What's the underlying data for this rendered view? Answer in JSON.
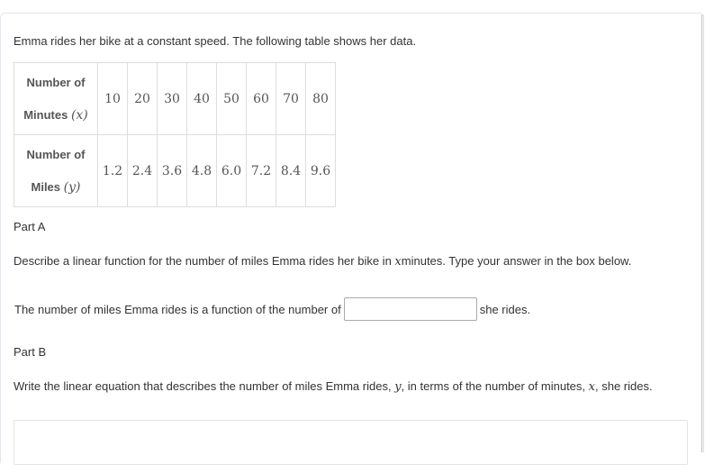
{
  "intro": "Emma rides her bike at a constant speed.  The following table shows her data.",
  "table": {
    "rows": [
      {
        "label_line1": "Number of",
        "label_line2": "Minutes",
        "label_var": "(x)",
        "values": [
          "10",
          "20",
          "30",
          "40",
          "50",
          "60",
          "70",
          "80"
        ]
      },
      {
        "label_line1": "Number of",
        "label_line2": "Miles",
        "label_var": "(y)",
        "values": [
          "1.2",
          "2.4",
          "3.6",
          "4.8",
          "6.0",
          "7.2",
          "8.4",
          "9.6"
        ]
      }
    ]
  },
  "partA": {
    "title": "Part A",
    "prompt_before": "Describe a linear function for the number of miles Emma rides her bike in ",
    "prompt_var": "x",
    "prompt_after": "minutes.  Type your answer in the box below.",
    "sentence_before": "The number of miles Emma rides is a function of the number of",
    "input_value": "",
    "sentence_after": "she rides."
  },
  "partB": {
    "title": "Part B",
    "prompt_1": "Write the linear equation that describes the number of miles Emma rides, ",
    "var_y": "y",
    "prompt_2": ", in terms of the number of minutes, ",
    "var_x": "x",
    "prompt_3": ", she rides.",
    "answer_value": ""
  }
}
